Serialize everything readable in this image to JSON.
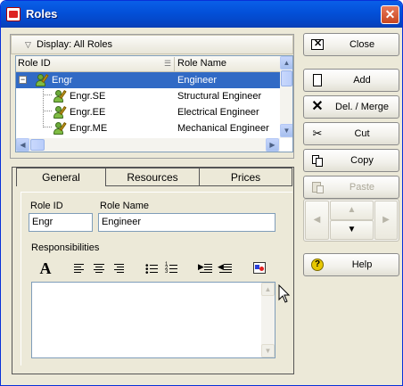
{
  "window": {
    "title": "Roles"
  },
  "display_bar": {
    "label": "Display: All Roles"
  },
  "grid": {
    "columns": [
      "Role ID",
      "Role Name"
    ],
    "rows": [
      {
        "id": "Engr",
        "name": "Engineer",
        "expander": "−"
      },
      {
        "id": "Engr.SE",
        "name": "Structural Engineer"
      },
      {
        "id": "Engr.EE",
        "name": "Electrical Engineer"
      },
      {
        "id": "Engr.ME",
        "name": "Mechanical Engineer"
      }
    ]
  },
  "tabs": [
    "General",
    "Resources",
    "Prices"
  ],
  "general": {
    "role_id_label": "Role ID",
    "role_id_value": "Engr",
    "role_name_label": "Role Name",
    "role_name_value": "Engineer",
    "responsibilities_label": "Responsibilities"
  },
  "buttons": {
    "close": "Close",
    "add": "Add",
    "delete_merge": "Del. / Merge",
    "cut": "Cut",
    "copy": "Copy",
    "paste": "Paste",
    "help": "Help"
  },
  "icons": {
    "title": "app-icon",
    "close_x": "close-icon",
    "close": "close-window-icon",
    "add": "new-document-icon",
    "delete": "x-icon",
    "cut": "scissors-icon",
    "copy": "copy-icon",
    "paste": "paste-icon",
    "help": "question-icon"
  },
  "colors": {
    "selection": "#316ac5",
    "titlebar": "#0350d8",
    "help_icon": "#e8c800"
  }
}
